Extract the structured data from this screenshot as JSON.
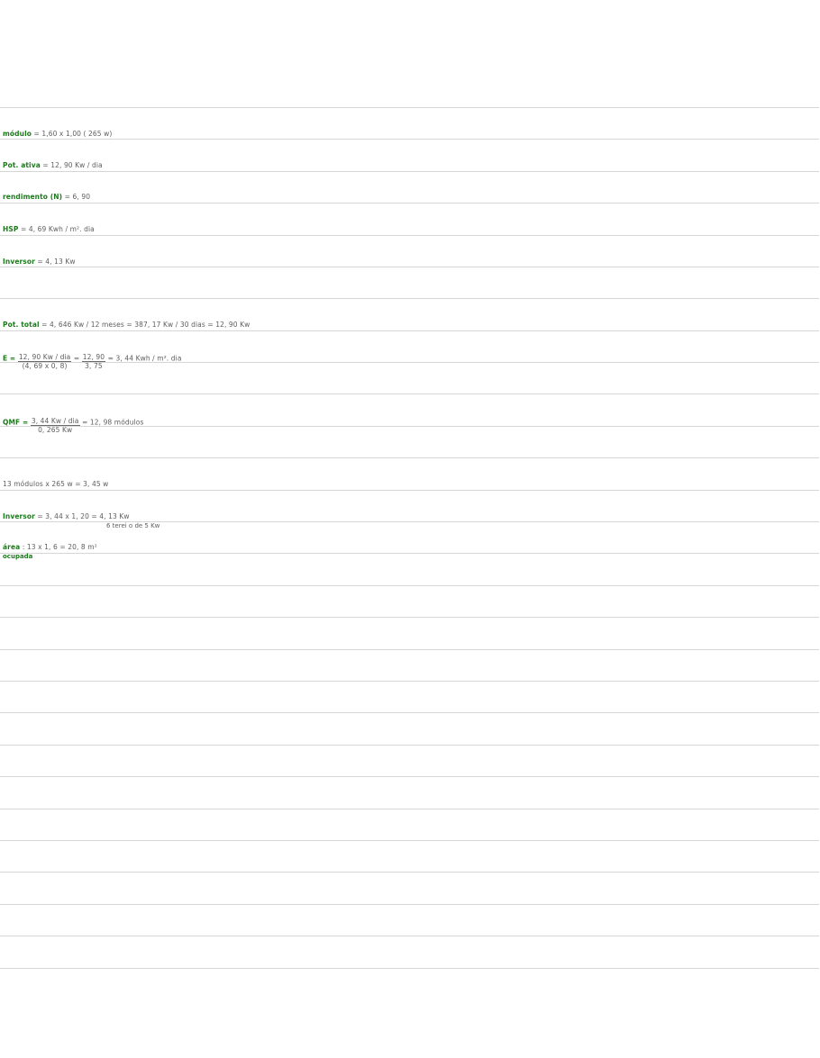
{
  "notes": {
    "modulo": {
      "label": "módulo",
      "value": "= 1,60 x 1,00 ( 265 w)"
    },
    "pot_ativa": {
      "label": "Pot. ativa",
      "value": "= 12, 90 Kw / dia"
    },
    "rendimento": {
      "label": "rendimento (N)",
      "value": "= 6, 90"
    },
    "hsp": {
      "label": "HSP",
      "value": "= 4, 69 Kwh / m². dia"
    },
    "inversor1": {
      "label": "Inversor",
      "value": "= 4, 13 Kw"
    },
    "pot_total": {
      "label": "Pot. total",
      "value": "= 4, 646 Kw / 12 meses = 387, 17 Kw / 30 dias = 12, 90 Kw"
    },
    "e_calc": {
      "label": "E =",
      "frac1_num": "12, 90 Kw / dia",
      "frac1_den": "(4, 69 x 0, 8)",
      "eq": "=",
      "frac2_num": "12, 90",
      "frac2_den": "3, 75",
      "result": "= 3, 44 Kwh / m². dia"
    },
    "qmf": {
      "label": "QMF =",
      "frac_num": "3, 44 Kw / dia",
      "frac_den": "0, 265 Kw",
      "result": "= 12, 98 módulos"
    },
    "modulos_total": {
      "value": "13 módulos x 265 w = 3, 45 w"
    },
    "inversor2": {
      "label": "Inversor",
      "value": "= 3, 44 x 1, 20 = 4, 13 Kw",
      "note": "6 terei o de 5 Kw"
    },
    "area": {
      "label": "área",
      "sublabel": "ocupada",
      "value": ": 13 x 1, 6 = 20, 8 m²"
    }
  }
}
